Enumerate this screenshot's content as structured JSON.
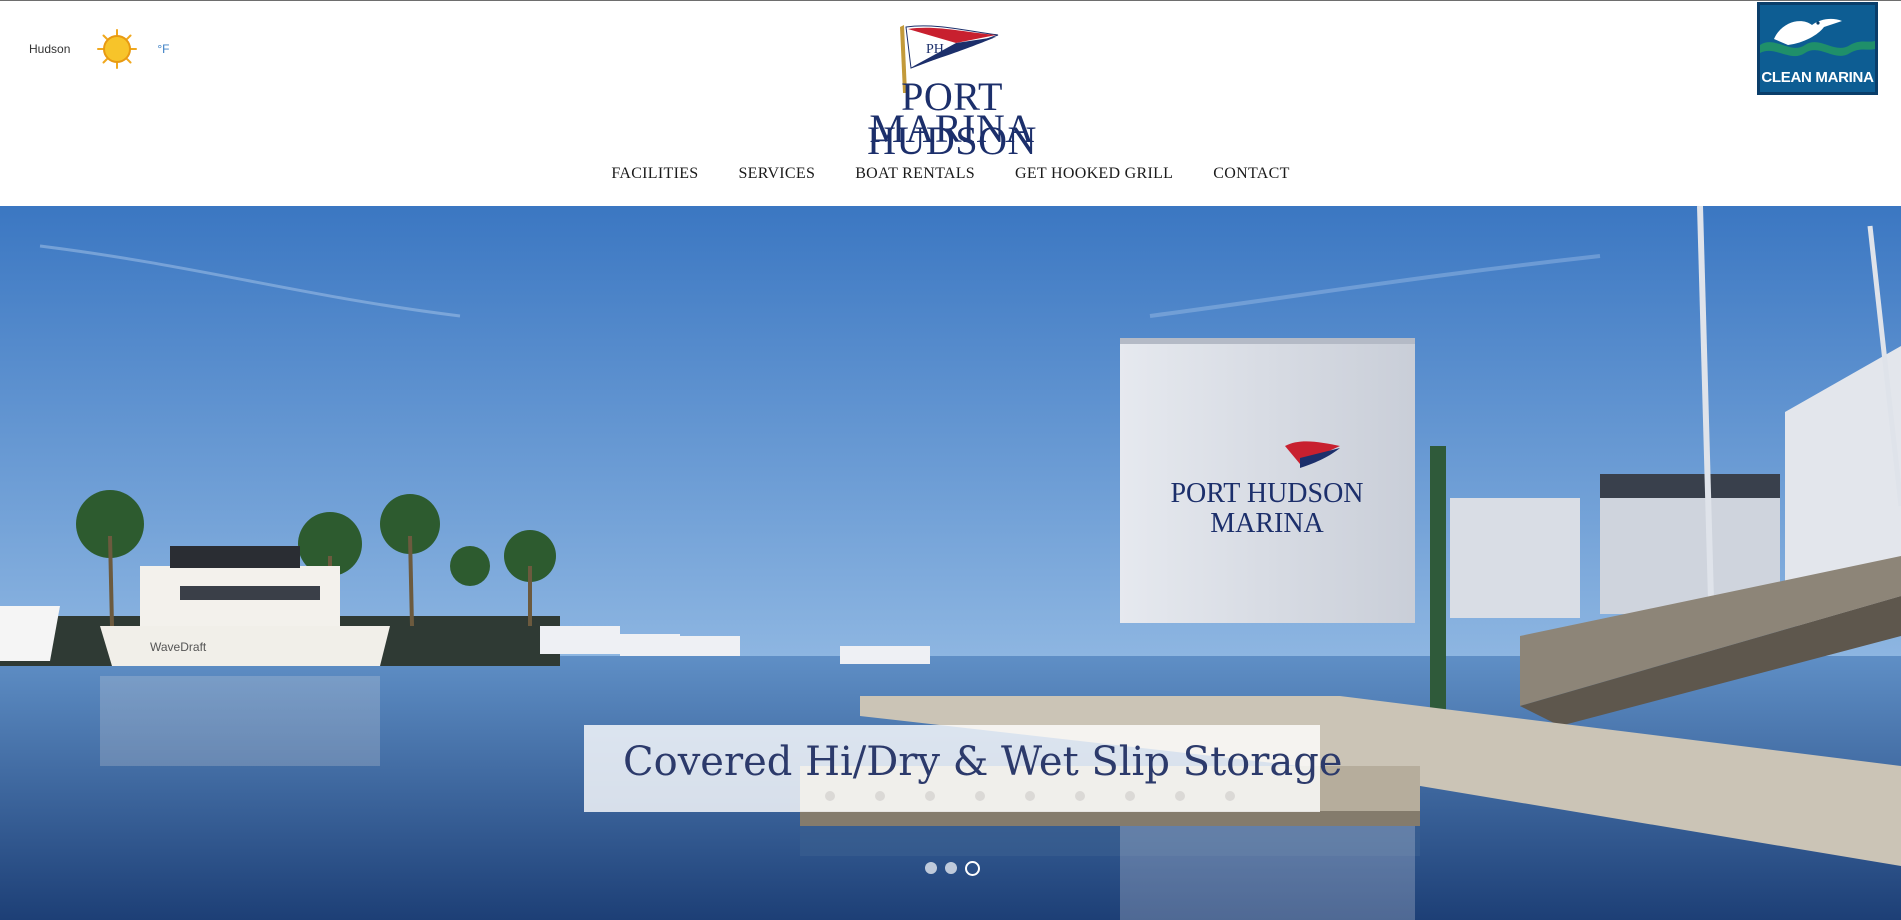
{
  "weather": {
    "location": "Hudson",
    "icon": "sun-icon",
    "unit": "°F"
  },
  "logo": {
    "line1": "PORT HUDSON",
    "line2": "MARINA",
    "flag_monogram": "PH"
  },
  "badge": {
    "text": "CLEAN MARINA",
    "icon": "pelican-icon"
  },
  "nav": {
    "items": [
      {
        "label": "FACILITIES"
      },
      {
        "label": "SERVICES"
      },
      {
        "label": "BOAT RENTALS"
      },
      {
        "label": "GET HOOKED GRILL"
      },
      {
        "label": "CONTACT"
      }
    ]
  },
  "hero": {
    "caption": "Covered Hi/Dry & Wet Slip Storage",
    "building_sign_line1": "PORT HUDSON",
    "building_sign_line2": "MARINA",
    "boat_name": "WaveDraft",
    "slides": {
      "count": 3,
      "active": 3
    }
  },
  "colors": {
    "brand_navy": "#1c2f6b",
    "brand_red": "#c8202f",
    "sky": "#3f7fc4",
    "unit_blue": "#3b7fc4"
  }
}
